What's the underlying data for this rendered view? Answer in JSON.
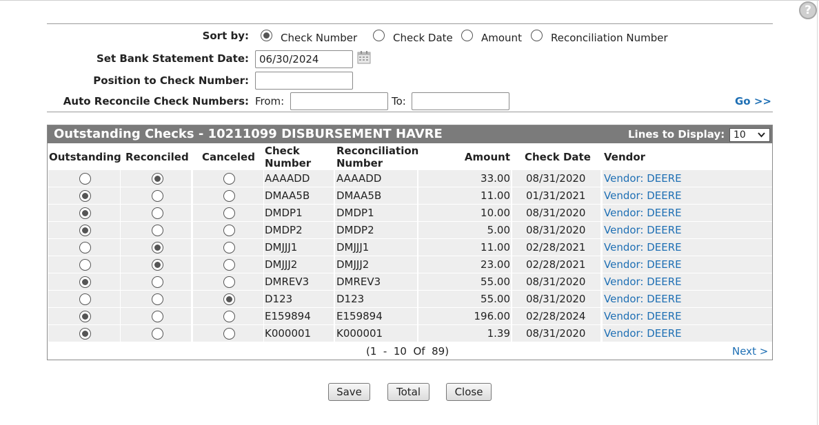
{
  "sort": {
    "label": "Sort by:",
    "options": [
      {
        "label": "Check Number",
        "selected": true
      },
      {
        "label": "Check Date",
        "selected": false
      },
      {
        "label": "Amount",
        "selected": false
      },
      {
        "label": "Reconciliation Number",
        "selected": false
      }
    ]
  },
  "bank_statement": {
    "label": "Set Bank Statement Date:",
    "value": "06/30/2024",
    "icon": "calendar-icon"
  },
  "position": {
    "label": "Position to Check Number:",
    "value": ""
  },
  "auto_reconcile": {
    "label": "Auto Reconcile Check Numbers:",
    "from_label": "From:",
    "to_label": "To:",
    "from_value": "",
    "to_value": "",
    "go_label": "Go >>"
  },
  "grid": {
    "title": "Outstanding Checks - 10211099 DISBURSEMENT HAVRE",
    "lines_label": "Lines to Display:",
    "lines_value": "10",
    "columns": {
      "outstanding": "Outstanding",
      "reconciled": "Reconciled",
      "canceled": "Canceled",
      "check_number_1": "Check",
      "check_number_2": "Number",
      "recon_number_1": "Reconciliation",
      "recon_number_2": "Number",
      "amount": "Amount",
      "check_date": "Check Date",
      "vendor": "Vendor"
    },
    "rows": [
      {
        "status": "reconciled",
        "check": "AAAADD",
        "recon": "AAAADD",
        "amount": "33.00",
        "date": "08/31/2020",
        "vendor": "Vendor: DEERE"
      },
      {
        "status": "outstanding",
        "check": "DMAA5B",
        "recon": "DMAA5B",
        "amount": "11.00",
        "date": "01/31/2021",
        "vendor": "Vendor: DEERE"
      },
      {
        "status": "outstanding",
        "check": "DMDP1",
        "recon": "DMDP1",
        "amount": "10.00",
        "date": "08/31/2020",
        "vendor": "Vendor: DEERE"
      },
      {
        "status": "outstanding",
        "check": "DMDP2",
        "recon": "DMDP2",
        "amount": "5.00",
        "date": "08/31/2020",
        "vendor": "Vendor: DEERE"
      },
      {
        "status": "reconciled",
        "check": "DMJJJ1",
        "recon": "DMJJJ1",
        "amount": "11.00",
        "date": "02/28/2021",
        "vendor": "Vendor: DEERE"
      },
      {
        "status": "reconciled",
        "check": "DMJJJ2",
        "recon": "DMJJJ2",
        "amount": "23.00",
        "date": "02/28/2021",
        "vendor": "Vendor: DEERE"
      },
      {
        "status": "outstanding",
        "check": "DMREV3",
        "recon": "DMREV3",
        "amount": "55.00",
        "date": "08/31/2020",
        "vendor": "Vendor: DEERE"
      },
      {
        "status": "canceled",
        "check": "D123",
        "recon": "D123",
        "amount": "55.00",
        "date": "08/31/2020",
        "vendor": "Vendor: DEERE"
      },
      {
        "status": "outstanding",
        "check": "E159894",
        "recon": "E159894",
        "amount": "196.00",
        "date": "02/28/2024",
        "vendor": "Vendor: DEERE"
      },
      {
        "status": "outstanding",
        "check": "K000001",
        "recon": "K000001",
        "amount": "1.39",
        "date": "08/31/2020",
        "vendor": "Vendor: DEERE"
      }
    ],
    "pager": "(1  -  10  Of  89)",
    "next_label": "Next >"
  },
  "buttons": {
    "save": "Save",
    "total": "Total",
    "close": "Close"
  },
  "colors": {
    "header_bg": "#7b7b7b",
    "link": "#1e6fb4",
    "row_bg": "#eeeeee"
  },
  "icons": {
    "help": "help-icon",
    "calendar": "calendar-icon",
    "dropdown": "chevron-down-icon"
  }
}
